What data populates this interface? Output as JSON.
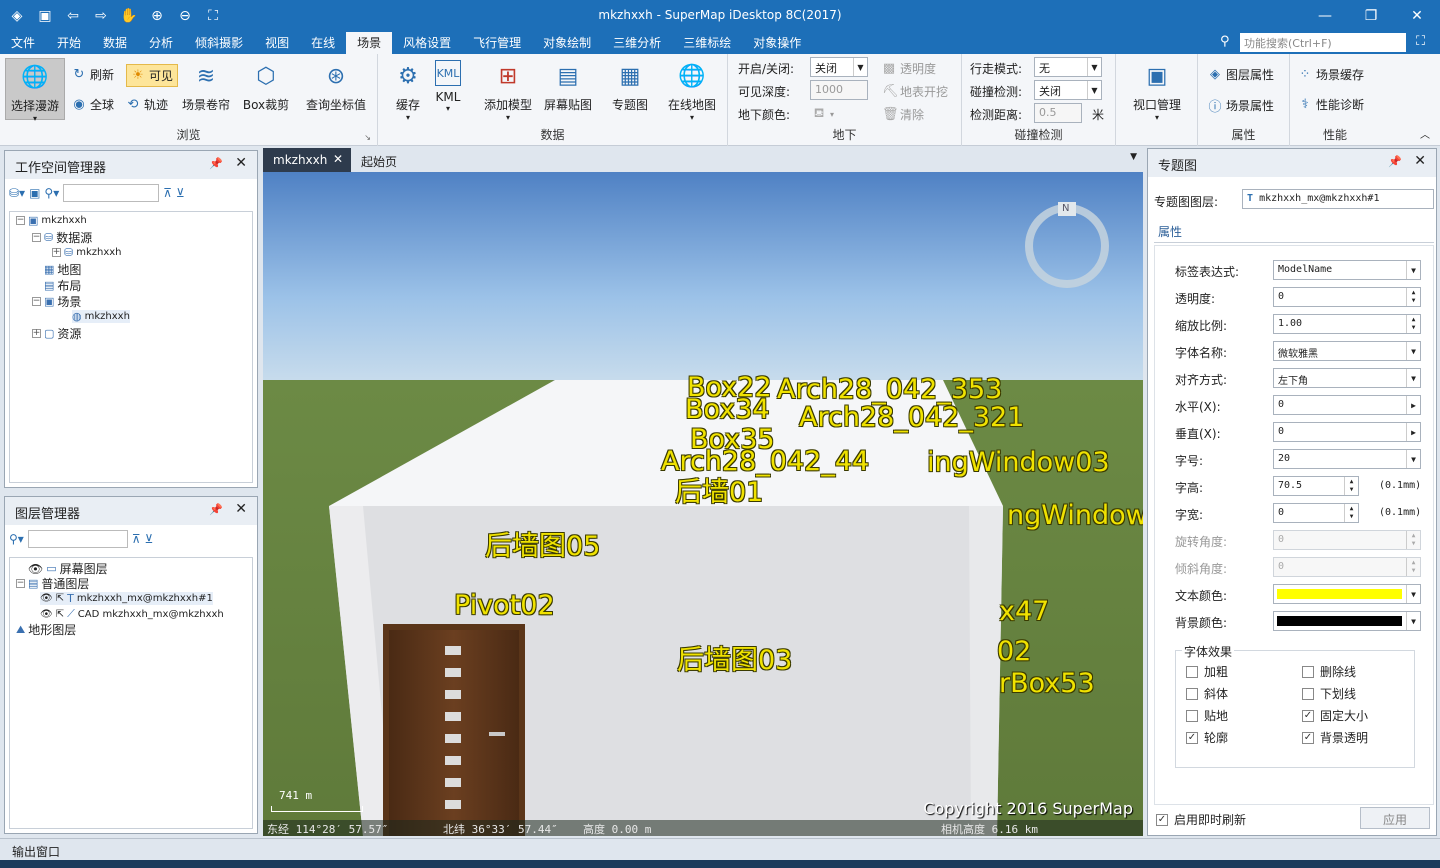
{
  "window": {
    "title": "mkzhxxh - SuperMap iDesktop 8C(2017)"
  },
  "menu": {
    "tabs": [
      "文件",
      "开始",
      "数据",
      "分析",
      "倾斜摄影",
      "视图",
      "在线",
      "场景",
      "风格设置",
      "飞行管理",
      "对象绘制",
      "三维分析",
      "三维标绘",
      "对象操作"
    ],
    "active": "场景",
    "search_placeholder": "功能搜索(Ctrl+F)"
  },
  "ribbon": {
    "browse": {
      "label": "浏览",
      "select_roam": "选择漫游",
      "refresh": "刷新",
      "visible": "可见",
      "globe": "全球",
      "track": "轨迹",
      "scene_curtain": "场景卷帘",
      "box_clip": "Box裁剪",
      "query_coord": "查询坐标值"
    },
    "data": {
      "label": "数据",
      "cache": "缓存",
      "kml": "KML",
      "add_model": "添加模型",
      "screen_paste": "屏幕贴图",
      "thematic": "专题图",
      "online_map": "在线地图"
    },
    "underground": {
      "label": "地下",
      "toggle_label": "开启/关闭:",
      "toggle_value": "关闭",
      "depth_label": "可见深度:",
      "depth_value": "1000",
      "color_label": "地下颜色:",
      "transparency": "透明度",
      "surface_dig": "地表开挖",
      "clear": "清除"
    },
    "collision": {
      "label": "碰撞检测",
      "walk_label": "行走模式:",
      "walk_value": "无",
      "check_label": "碰撞检测:",
      "check_value": "关闭",
      "dist_label": "检测距离:",
      "dist_value": "0.5",
      "dist_unit": "米"
    },
    "viewport": {
      "label": "视口管理"
    },
    "props": {
      "label": "属性",
      "layer_props": "图层属性",
      "scene_props": "场景属性"
    },
    "perf": {
      "label": "性能",
      "scene_cache": "场景缓存",
      "perf_diag": "性能诊断"
    }
  },
  "workspace": {
    "title": "工作空间管理器",
    "nodes": [
      "mkzhxxh",
      "数据源",
      "mkzhxxh",
      "地图",
      "布局",
      "场景",
      "mkzhxxh",
      "资源"
    ]
  },
  "layers": {
    "title": "图层管理器",
    "nodes": [
      "屏幕图层",
      "普通图层",
      "mkzhxxh_mx@mkzhxxh#1",
      "CAD mkzhxxh_mx@mkzhxxh",
      "地形图层"
    ]
  },
  "doc_tabs": [
    "mkzhxxh",
    "起始页"
  ],
  "scene": {
    "compass": "N",
    "labels": [
      "Box22",
      "Arch28_042_353",
      "Box34",
      "Arch28_042_321",
      "Box35",
      "Arch28_042_44",
      "ingWindow03",
      "后墙01",
      "ngWindow",
      "后墙图05",
      "Pivot02",
      "后墙图03",
      "x47",
      "02",
      "rBox53"
    ],
    "scale": "741 m",
    "copyright": "Copyright 2016 SuperMap",
    "lon": "东经 114°28′ 57.57″",
    "lat": "北纬 36°33′ 57.44″",
    "alt": "高度 0.00 m",
    "cam": "相机高度 6.16 km"
  },
  "thematic": {
    "title": "专题图",
    "layer_label": "专题图图层:",
    "layer_value": "mkzhxxh_mx@mkzhxxh#1",
    "tab": "属性",
    "fields": [
      {
        "label": "标签表达式:",
        "value": "ModelName"
      },
      {
        "label": "透明度:",
        "value": "0"
      },
      {
        "label": "缩放比例:",
        "value": "1.00"
      },
      {
        "label": "字体名称:",
        "value": "微软雅黑"
      },
      {
        "label": "对齐方式:",
        "value": "左下角"
      },
      {
        "label": "水平(X):",
        "value": "0"
      },
      {
        "label": "垂直(X):",
        "value": "0"
      },
      {
        "label": "字号:",
        "value": "20"
      },
      {
        "label": "字高:",
        "value": "70.5"
      },
      {
        "label": "字宽:",
        "value": "0"
      },
      {
        "label": "旋转角度:",
        "value": "0"
      },
      {
        "label": "倾斜角度:",
        "value": "0"
      },
      {
        "label": "文本颜色:",
        "value": ""
      },
      {
        "label": "背景颜色:",
        "value": ""
      }
    ],
    "unit": "(0.1mm)",
    "text_color": "#ffff00",
    "bg_color": "#000000",
    "effects_title": "字体效果",
    "effects": [
      {
        "label": "加粗",
        "checked": false
      },
      {
        "label": "删除线",
        "checked": false
      },
      {
        "label": "斜体",
        "checked": false
      },
      {
        "label": "下划线",
        "checked": false
      },
      {
        "label": "贴地",
        "checked": false
      },
      {
        "label": "固定大小",
        "checked": true
      },
      {
        "label": "轮廓",
        "checked": true
      },
      {
        "label": "背景透明",
        "checked": true
      }
    ],
    "instant_refresh": "启用即时刷新",
    "apply": "应用"
  },
  "output": {
    "title": "输出窗口"
  }
}
